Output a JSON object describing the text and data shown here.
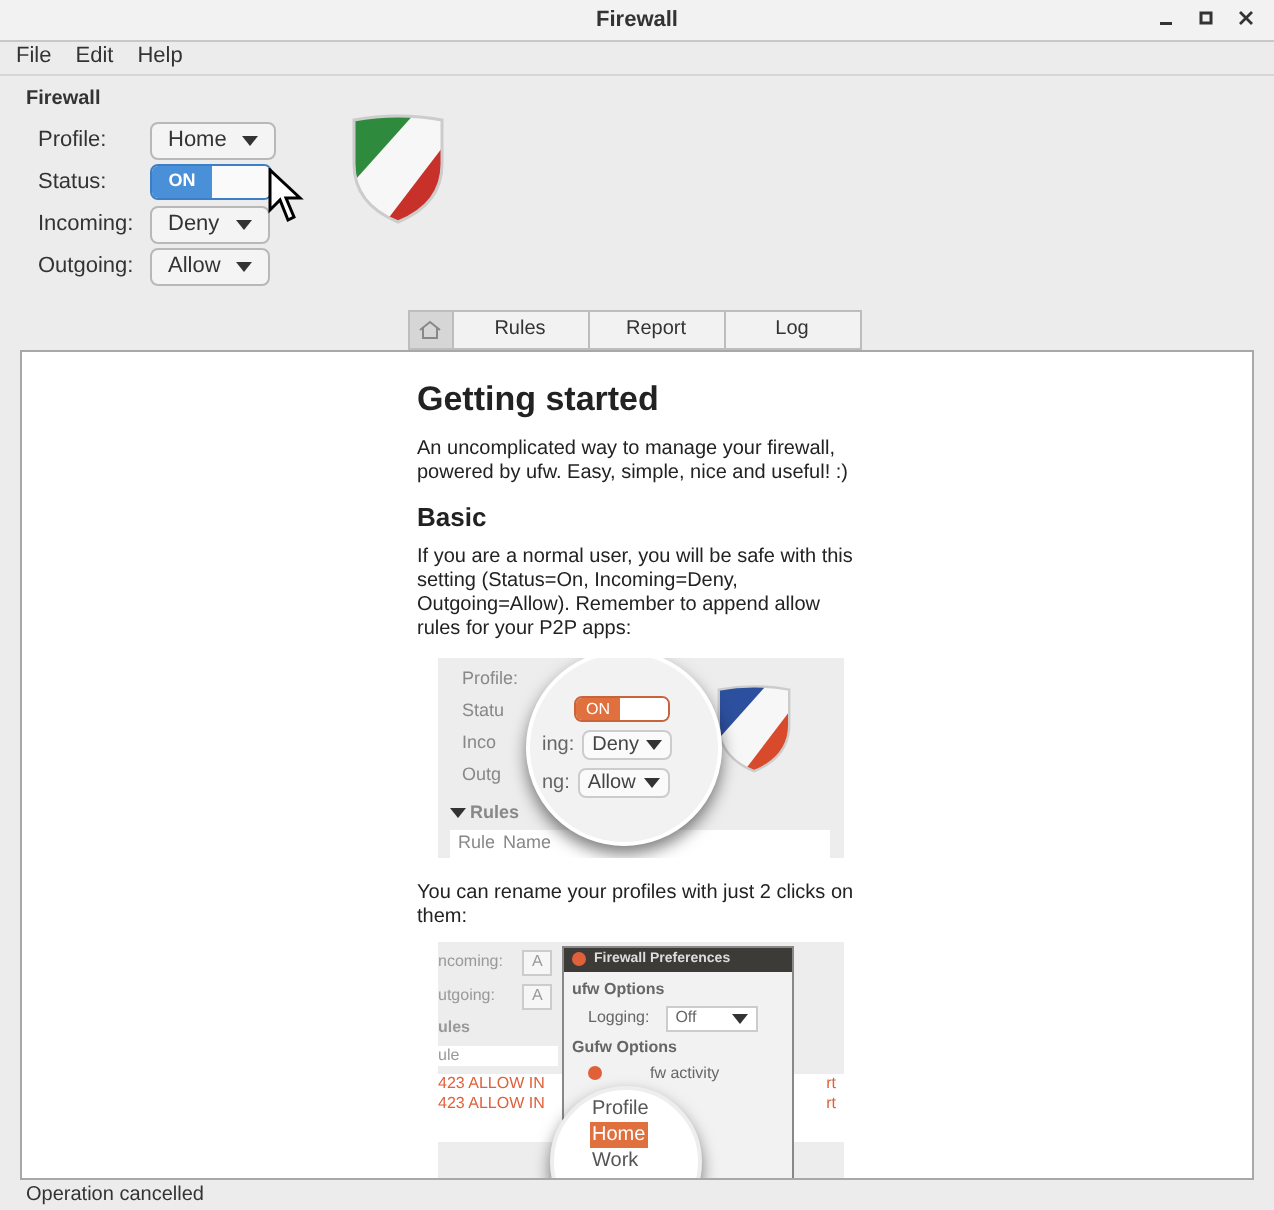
{
  "window": {
    "title": "Firewall"
  },
  "menu": [
    "File",
    "Edit",
    "Help"
  ],
  "section_title": "Firewall",
  "settings": [
    {
      "label": "Profile:",
      "kind": "dropdown",
      "value": "Home"
    },
    {
      "label": "Status:",
      "kind": "switch",
      "on": true,
      "value": "ON"
    },
    {
      "label": "Incoming:",
      "kind": "dropdown",
      "value": "Deny"
    },
    {
      "label": "Outgoing:",
      "kind": "dropdown",
      "value": "Allow"
    }
  ],
  "tabs": [
    {
      "kind": "icon",
      "selected": true
    },
    {
      "kind": "text",
      "label": "Rules",
      "selected": false
    },
    {
      "kind": "text",
      "label": "Report",
      "selected": false
    },
    {
      "kind": "text",
      "label": "Log",
      "selected": false
    }
  ],
  "content": {
    "heading": "Getting started",
    "intro": "An uncomplicated way to manage your firewall, powered by ufw. Easy, simple, nice and useful! :)",
    "subheading": "Basic",
    "paragraph_1": "If you are a normal user, you will be safe with this setting (Status=On, Incoming=Deny, Outgoing=Allow). Remember to append allow rules for your P2P apps:",
    "screenshot_1": {
      "labels": [
        "Profile:",
        "Statu",
        "Inco",
        "Outg"
      ],
      "zoom_labels": [
        "ing:",
        "ng:"
      ],
      "switch": "ON",
      "switch_on": true,
      "incoming": "Deny",
      "outgoing": "Allow",
      "section": "Rules",
      "columns": [
        "Rule",
        "Name"
      ]
    },
    "paragraph_2": "You can rename your profiles with just 2 clicks on them:",
    "screenshot_2": {
      "labels": [
        "ncoming:",
        "utgoing:"
      ],
      "fields": [
        "A",
        "A"
      ],
      "section": "ules",
      "column": "ule",
      "rows": [
        "423 ALLOW IN",
        "423 ALLOW IN"
      ],
      "row_tails": [
        "rt",
        "rt"
      ],
      "dialog": {
        "title": "Firewall Preferences",
        "group_1": "ufw Options",
        "logging_label": "Logging:",
        "logging_value": "Off",
        "group_2": "Gufw Options",
        "option": "fw activity",
        "option_checked": true
      },
      "zoom_items": [
        {
          "label": "Profile",
          "selected": false
        },
        {
          "label": "Home",
          "selected": true
        },
        {
          "label": "Work",
          "selected": false
        }
      ]
    }
  },
  "status_bar": "Operation cancelled"
}
